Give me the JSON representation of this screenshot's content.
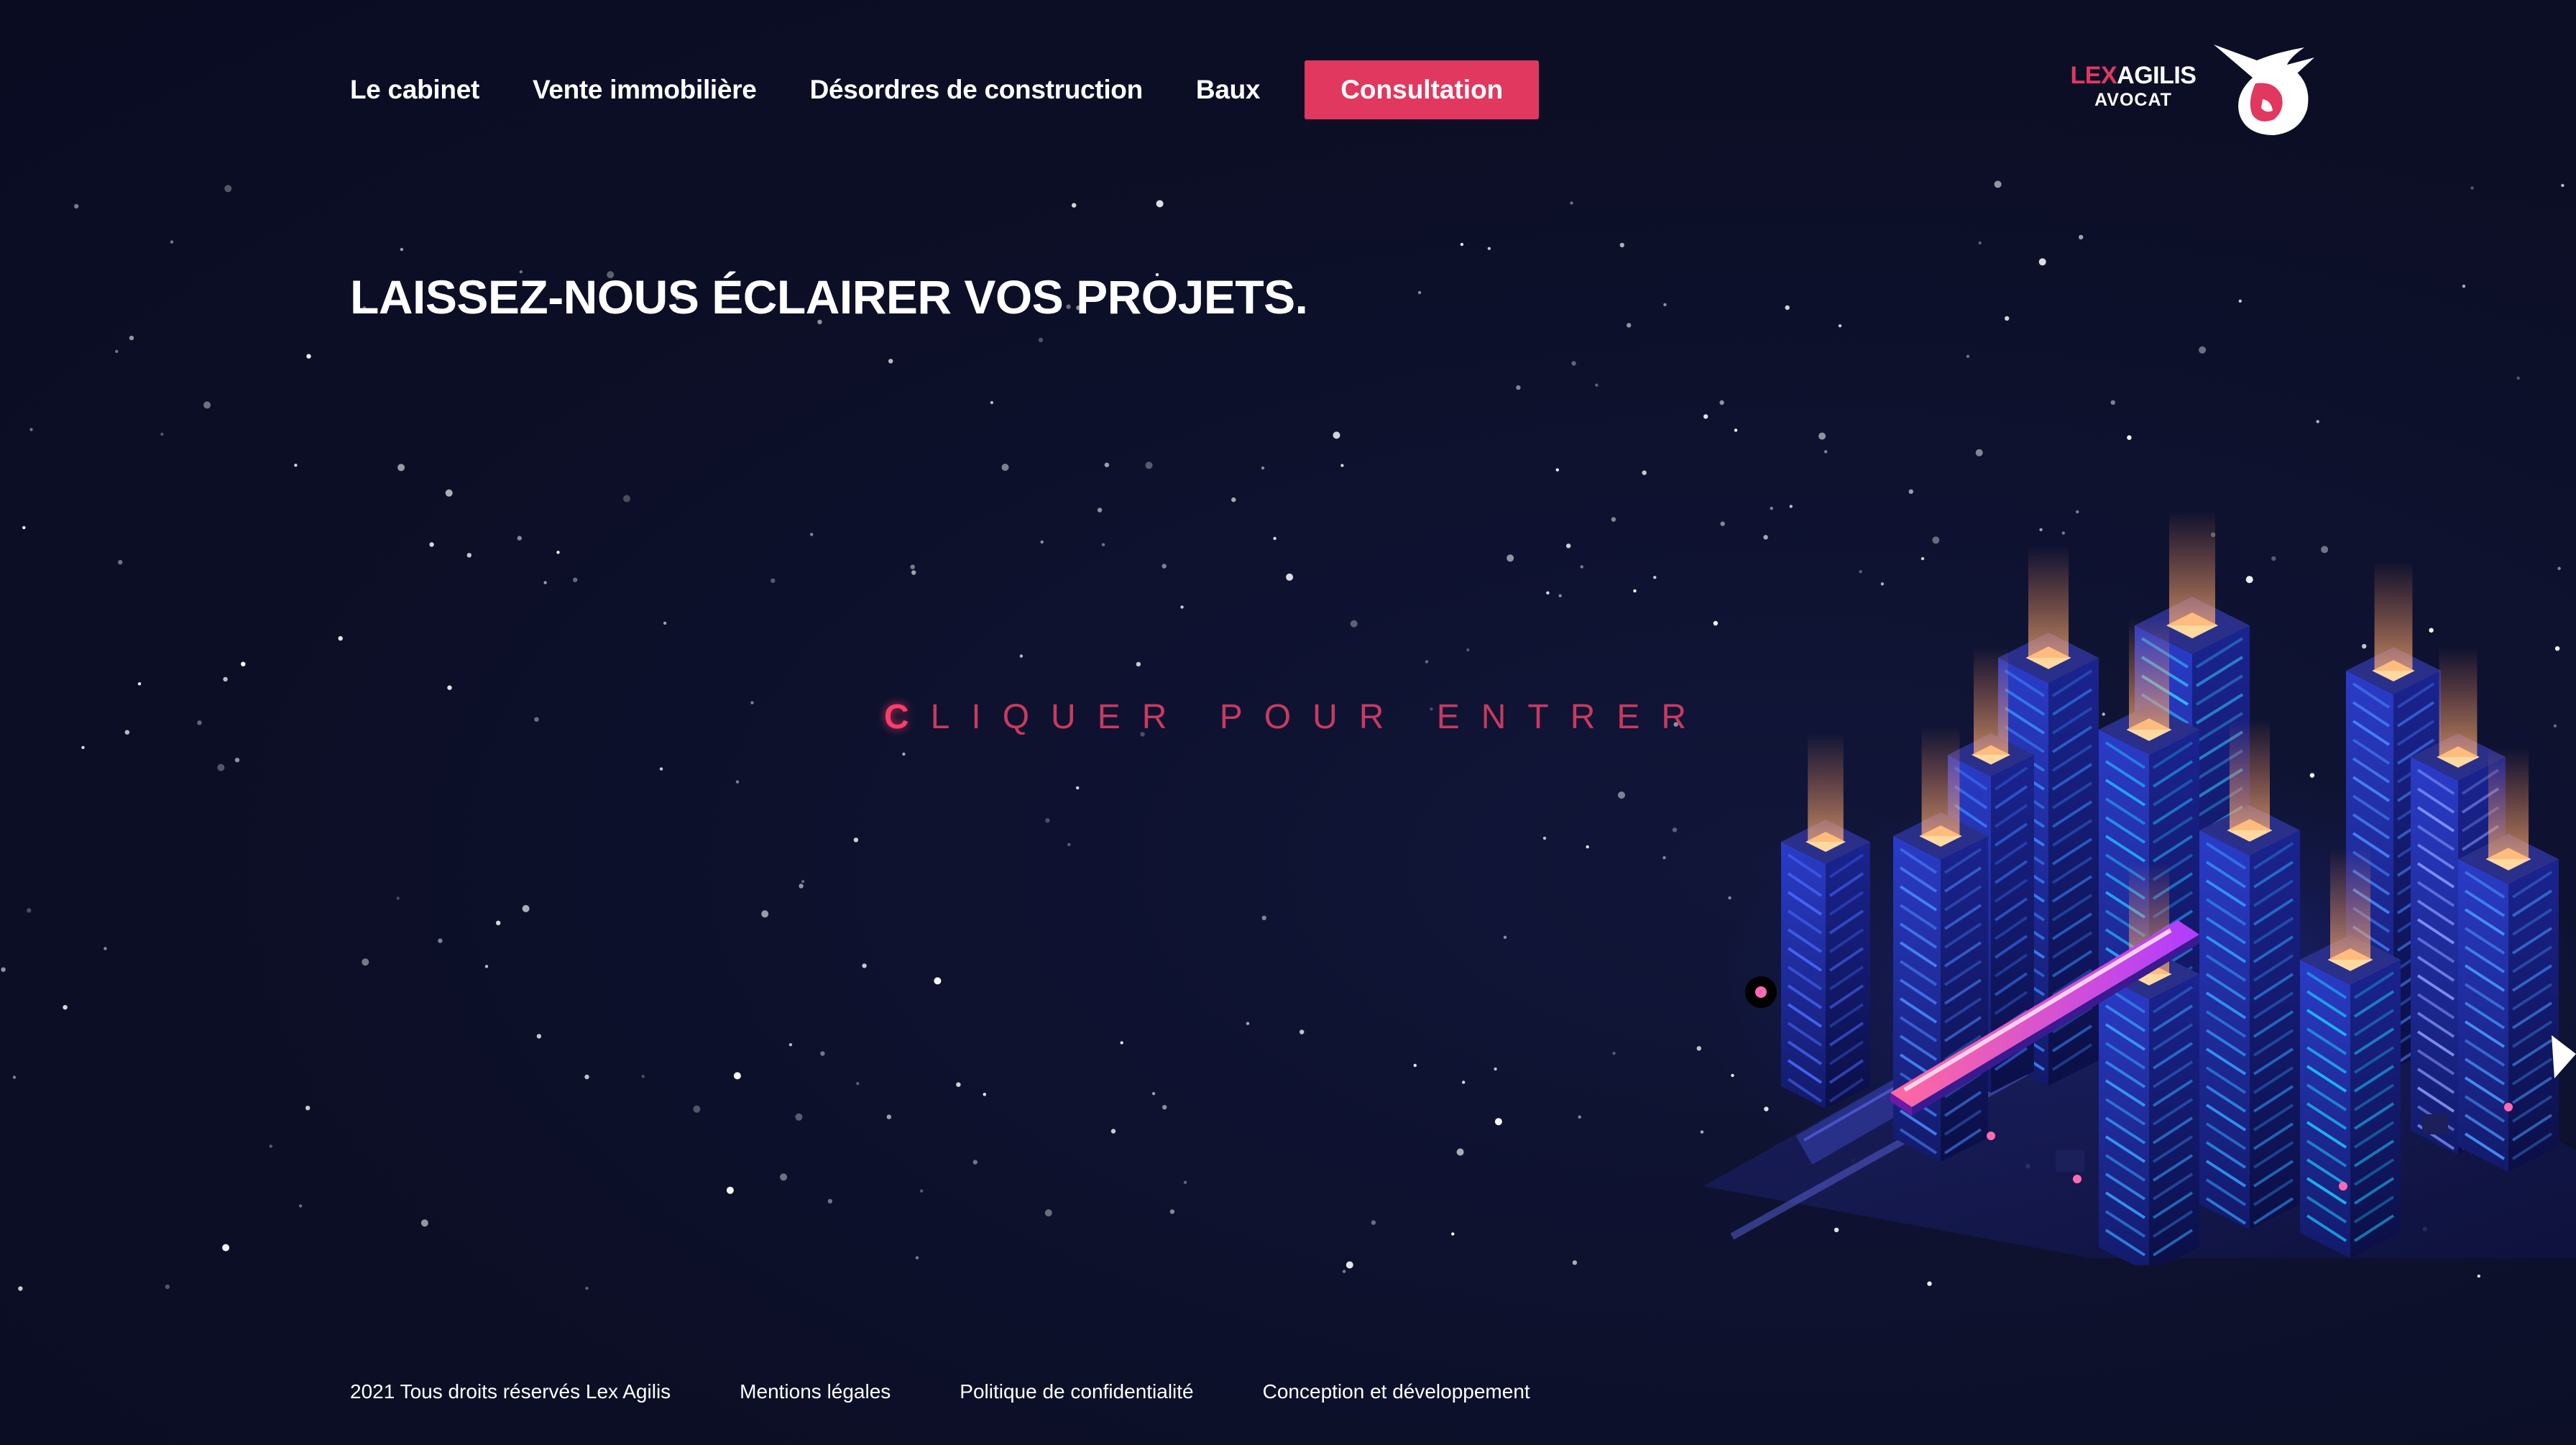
{
  "nav": {
    "items": [
      {
        "label": "Le cabinet"
      },
      {
        "label": "Vente immobilière"
      },
      {
        "label": "Désordres de construction"
      },
      {
        "label": "Baux"
      }
    ],
    "cta_label": "Consultation"
  },
  "logo": {
    "name_lex": "LEX",
    "name_agilis": "AGILIS",
    "subtitle": "AVOCAT"
  },
  "hero": {
    "headline": "LAISSEZ-NOUS ÉCLAIRER VOS PROJETS.",
    "enter_first_letter": "C",
    "enter_rest": "LIQUER POUR ENTRER"
  },
  "footer": {
    "copyright": "2021 Tous droits réservés Lex Agilis",
    "legal": "Mentions légales",
    "privacy": "Politique de confidentialité",
    "credits": "Conception et développement"
  },
  "colors": {
    "background": "#0d1029",
    "accent": "#e0385f",
    "text": "#ffffff"
  }
}
